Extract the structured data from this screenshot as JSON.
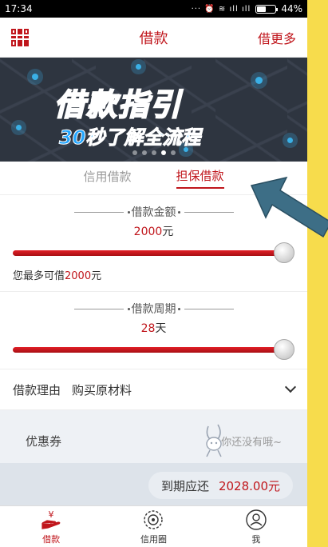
{
  "status": {
    "time": "17:34",
    "icons": "··· ⏰ ≋ ıll ıll",
    "battery_text": "44%",
    "battery_level": 0.44
  },
  "header": {
    "title": "借款",
    "more": "借更多",
    "left_icon": "qr-code-icon"
  },
  "banner": {
    "headline": "借款指引",
    "subline": "30秒了解全流程",
    "pages": 5,
    "active_page": 3
  },
  "tabs": [
    {
      "label": "信用借款",
      "active": false
    },
    {
      "label": "担保借款",
      "active": true
    }
  ],
  "amount_section": {
    "title": "借款金额",
    "value": "2000",
    "unit": "元",
    "slider_level": 1.0,
    "max_prefix": "您最多可借",
    "max_value": "2000",
    "max_unit": "元"
  },
  "period_section": {
    "title": "借款周期",
    "value": "28",
    "unit": "天",
    "slider_level": 1.0
  },
  "reason": {
    "label": "借款理由",
    "value": "购买原材料",
    "icon": "chevron-down-icon"
  },
  "coupon": {
    "label": "优惠券",
    "empty_text": "你还没有哦~"
  },
  "due": {
    "label": "到期应还",
    "value": "2028.00元"
  },
  "nav": [
    {
      "label": "借款",
      "icon": "yuan-hand-icon",
      "active": true
    },
    {
      "label": "信用圈",
      "icon": "credit-circle-icon",
      "active": false
    },
    {
      "label": "我",
      "icon": "user-icon",
      "active": false
    }
  ],
  "colors": {
    "brand": "#c0161c",
    "side_strip": "#f7dc4c",
    "coupon_bg": "#eef1f5"
  }
}
